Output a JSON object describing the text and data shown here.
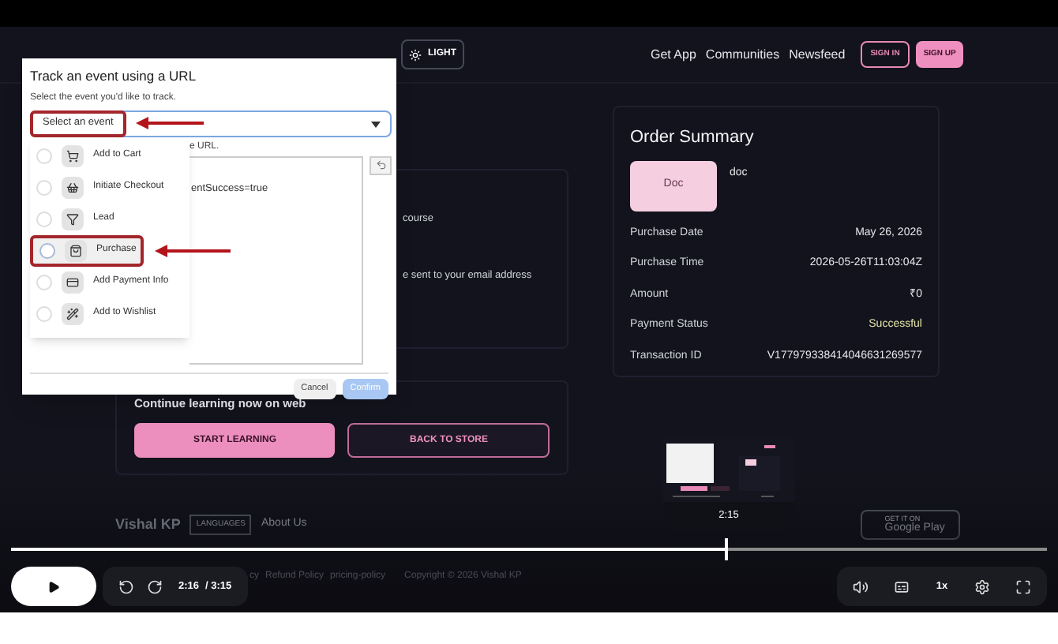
{
  "header": {
    "theme_button": "LIGHT",
    "nav": [
      "Get App",
      "Communities",
      "Newsfeed"
    ],
    "sign_in": "SIGN IN",
    "sign_up": "SIGN UP"
  },
  "left_card": {
    "lines": [
      "course",
      "e sent to your email address"
    ]
  },
  "continue_card": {
    "title": "Continue learning now on web",
    "buttons": [
      {
        "label": "START LEARNING",
        "kind": "primary"
      },
      {
        "label": "BACK TO STORE",
        "kind": "outline"
      }
    ]
  },
  "order_summary": {
    "title": "Order Summary",
    "tile": "Doc",
    "product": "doc",
    "rows": [
      {
        "label": "Purchase Date",
        "value": "May 26, 2026",
        "kind": "plain"
      },
      {
        "label": "Purchase Time",
        "value": "2026-05-26T11:03:04Z",
        "kind": "plain"
      },
      {
        "label": "Amount",
        "value": "₹0",
        "kind": "plain"
      },
      {
        "label": "Payment Status",
        "value": "Successful",
        "kind": "status"
      },
      {
        "label": "Transaction ID",
        "value": "V177979338414046631269577",
        "kind": "plain"
      }
    ]
  },
  "footer": {
    "brand": "Vishal KP",
    "languages": "LANGUAGES",
    "about": "About Us",
    "links": [
      "cy",
      "Refund Policy",
      "pricing-policy"
    ],
    "copyright": "Copyright © 2026 Vishal KP",
    "store_small": "GET IT ON",
    "store": "Google Play"
  },
  "dialog": {
    "title": "Track an event using a URL",
    "prompt": "Select the event you'd like to track.",
    "select": {
      "placeholder": "Select an event"
    },
    "url_label": "e URL.",
    "url_value": "entSuccess=true",
    "options": [
      {
        "label": "Add to Cart",
        "selected": false,
        "hovered": false
      },
      {
        "label": "Initiate Checkout",
        "selected": false,
        "hovered": false
      },
      {
        "label": "Lead",
        "selected": false,
        "hovered": false
      },
      {
        "label": "Purchase",
        "selected": false,
        "hovered": true
      },
      {
        "label": "Add Payment Info",
        "selected": false,
        "hovered": false
      },
      {
        "label": "Add to Wishlist",
        "selected": false,
        "hovered": false
      }
    ],
    "buttons": [
      {
        "label": "Cancel",
        "disabled": false
      },
      {
        "label": "Confirm",
        "disabled": true
      }
    ]
  },
  "player": {
    "progress": {
      "level": 0.69
    },
    "preview_time": "2:15",
    "time": "2:16",
    "duration": "/ 3:15",
    "speed": "1x"
  }
}
